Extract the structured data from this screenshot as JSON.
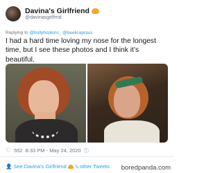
{
  "tweet": {
    "display_name": "Davina's Girlfriend",
    "handle": "@davinasgirlfrnd",
    "reply_prefix": "Replying to ",
    "reply_handles": "@hollyhopkins_ @beelicapraus",
    "text": "I had a hard time loving my nose for the longest time, but I see these photos and I think it’s beautiful.",
    "likes": "552",
    "timestamp": "8:33 PM - May 24, 2020",
    "see_more_prefix": "See Davina's Girlfriend",
    "see_more_suffix": "'s other Tweets"
  },
  "icons": {
    "avatar": "profile-photo",
    "badge": "yellow-heart-emoji",
    "like": "heart-outline-icon",
    "info": "info-icon",
    "profile": "person-icon"
  },
  "colors": {
    "link": "#1da1f2",
    "muted": "#657786",
    "accent": "#f5a623"
  },
  "watermark": "boredpanda.com"
}
